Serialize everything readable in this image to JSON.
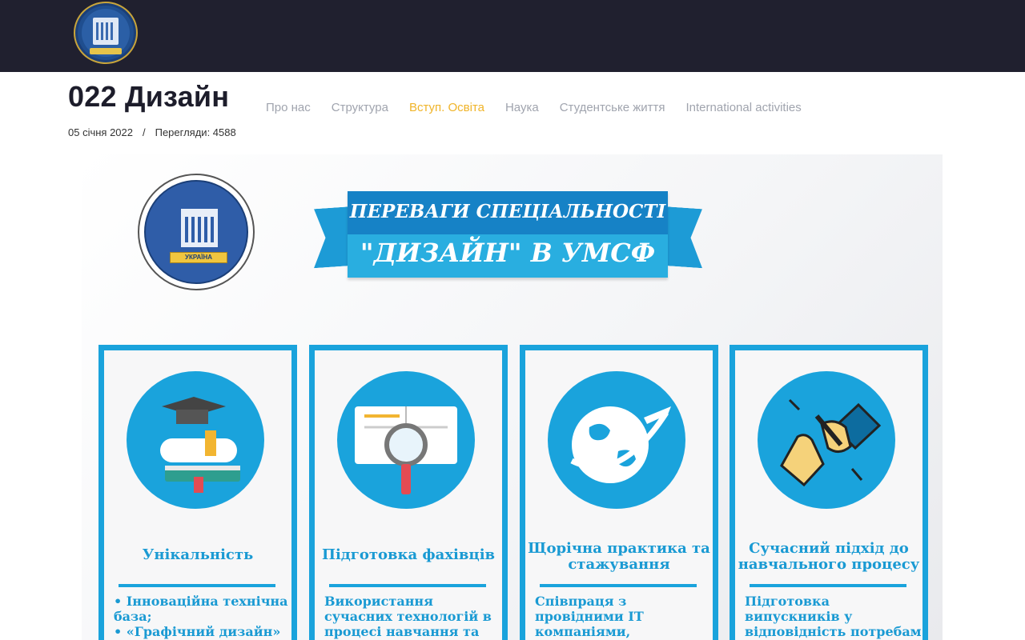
{
  "header": {
    "logo_alt": "University of Customs and Finance"
  },
  "page": {
    "title": "022 Дизайн",
    "date": "05 січня 2022",
    "separator": "/",
    "views": "Перегляди: 4588"
  },
  "nav": {
    "items": [
      {
        "label": "Про нас"
      },
      {
        "label": "Структура"
      },
      {
        "label": "Вступ. Освіта",
        "active": true
      },
      {
        "label": "Наука"
      },
      {
        "label": "Студентське життя"
      },
      {
        "label": "International activities"
      }
    ]
  },
  "banner": {
    "seal_band": "УКРАЇНА",
    "ribbon_line1": "ПЕРЕВАГИ СПЕЦІАЛЬНОСТІ",
    "ribbon_line2": "\"ДИЗАЙН\" В УМСФ",
    "cards": [
      {
        "icon": "graduation-icon",
        "title": "Унікальність",
        "body": "• Інноваційна технічна база;\n• «Графічний дизайн»"
      },
      {
        "icon": "book-magnifier-icon",
        "title": "Підготовка фахівців",
        "body": "Використання сучасних технологій в процесі навчання та"
      },
      {
        "icon": "globe-plane-icon",
        "title": "Щорічна практика та стажування",
        "body": "Співпраця з провідними IT компаніями, компаніями у сфері"
      },
      {
        "icon": "handshake-icon",
        "title": "Сучасний підхід до навчального процесу",
        "body": "Підготовка випускників у відповідність потребам"
      }
    ]
  },
  "colors": {
    "topbar": "#20202f",
    "accent": "#f0b429",
    "brand_blue": "#1aa3dc"
  }
}
